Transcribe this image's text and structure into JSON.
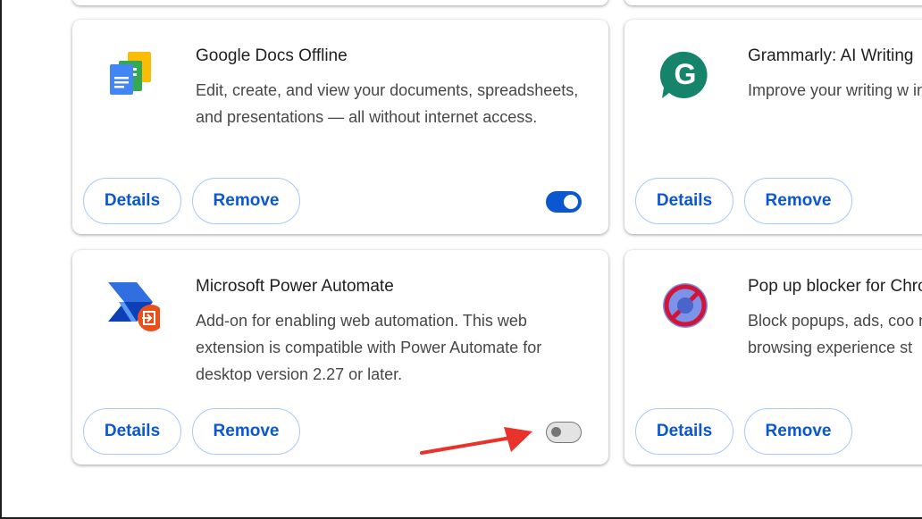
{
  "extensions": [
    {
      "name": "Google Docs Offline",
      "description": "Edit, create, and view your documents, spreadsheets, and presentations — all without internet access.",
      "details_label": "Details",
      "remove_label": "Remove",
      "enabled": true,
      "icon": "google-docs-icon"
    },
    {
      "name": "Grammarly: AI Writing",
      "description": "Improve your writing w including generative AI more.",
      "details_label": "Details",
      "remove_label": "Remove",
      "icon": "grammarly-icon"
    },
    {
      "name": "Microsoft Power Automate",
      "description": "Add-on for enabling web automation. This web extension is compatible with Power Automate for desktop version 2.27 or later.",
      "details_label": "Details",
      "remove_label": "Remove",
      "enabled": false,
      "icon": "power-automate-icon"
    },
    {
      "name": "Pop up blocker for Chro",
      "description": "Block popups, ads, coo notifications, ads on so browsing experience st",
      "details_label": "Details",
      "remove_label": "Remove",
      "icon": "popup-blocker-icon"
    }
  ],
  "colors": {
    "accent": "#0b57d0",
    "button_border": "#a8c7fa",
    "annotation_arrow": "#e8322a"
  }
}
